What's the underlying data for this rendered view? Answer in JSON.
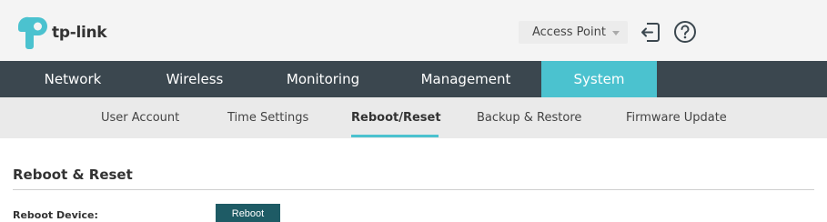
{
  "header": {
    "logo_text": "tp-link",
    "mode_select": {
      "selected": "Access Point"
    },
    "icons": {
      "logout": "logout-icon",
      "help": "help-icon"
    }
  },
  "main_nav": {
    "tabs": [
      {
        "label": "Network"
      },
      {
        "label": "Wireless"
      },
      {
        "label": "Monitoring"
      },
      {
        "label": "Management"
      },
      {
        "label": "System",
        "active": true
      }
    ]
  },
  "sub_nav": {
    "items": [
      {
        "label": "User Account"
      },
      {
        "label": "Time Settings"
      },
      {
        "label": "Reboot/Reset",
        "active": true
      },
      {
        "label": "Backup & Restore"
      },
      {
        "label": "Firmware Update"
      }
    ]
  },
  "content": {
    "section_title": "Reboot & Reset",
    "reboot_label": "Reboot Device:",
    "reboot_button": "Reboot"
  },
  "colors": {
    "accent": "#4bc2cf",
    "nav_bg": "#3b474f",
    "header_bg": "#f4f4f4",
    "subnav_bg": "#eaeaea",
    "button_bg": "#1e5b65"
  }
}
